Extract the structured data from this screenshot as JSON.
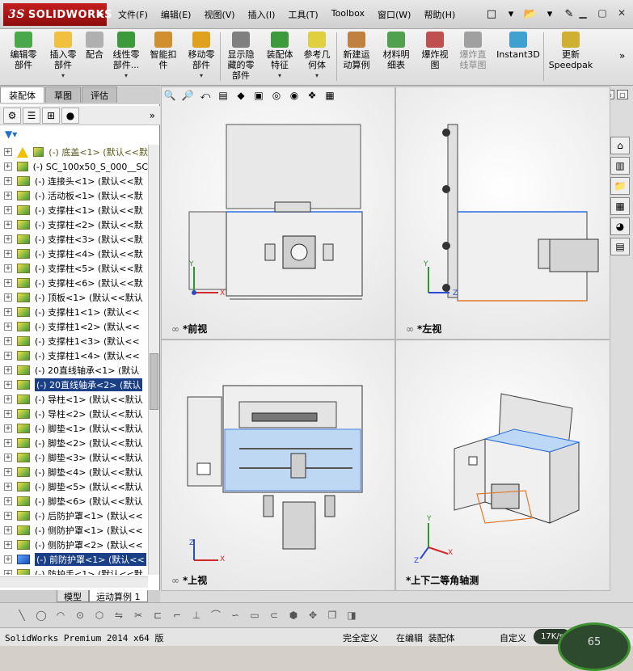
{
  "app": {
    "brand": "SOLIDWORKS",
    "brand_prefix": "3S",
    "status_app": "SolidWorks Premium 2014 x64 版",
    "status_def": "完全定义",
    "status_edit": "在编辑 装配体",
    "status_custom": "自定义",
    "speed": "17K/s",
    "gauge": "65"
  },
  "menus": [
    "文件(F)",
    "编辑(E)",
    "视图(V)",
    "插入(I)",
    "工具(T)",
    "Toolbox",
    "窗口(W)",
    "帮助(H)"
  ],
  "ribbon": [
    {
      "label": "编辑零\n部件",
      "color": "#4aa84a"
    },
    {
      "label": "插入零\n部件",
      "color": "#f0c040"
    },
    {
      "label": "配合",
      "color": "#b0b0b0"
    },
    {
      "label": "线性零\n部件...",
      "color": "#3c9a3c"
    },
    {
      "label": "智能扣\n件",
      "color": "#d09030"
    },
    {
      "label": "移动零\n部件",
      "color": "#e0a020"
    },
    {
      "label": "显示隐\n藏的零\n部件",
      "color": "#808080"
    },
    {
      "label": "装配体\n特征",
      "color": "#3c9a3c"
    },
    {
      "label": "参考几\n何体",
      "color": "#e0d040"
    },
    {
      "label": "新建运\n动算例",
      "color": "#c08040"
    },
    {
      "label": "材料明\n细表",
      "color": "#50a050"
    },
    {
      "label": "爆炸视\n图",
      "color": "#c05050"
    },
    {
      "label": "爆炸直\n线草图",
      "color": "#a0a0a0"
    },
    {
      "label": "Instant3D",
      "color": "#40a0d0"
    },
    {
      "label": "更新\nSpeedpak",
      "color": "#d0b030"
    }
  ],
  "panel_tabs": [
    "装配体",
    "草图",
    "评估"
  ],
  "tree": [
    {
      "label": "(-) 底盖<1> (默认<<默",
      "kind": "warn"
    },
    {
      "label": "(-) SC_100x50_S_000__SC",
      "kind": "normal"
    },
    {
      "label": "(-) 连接头<1> (默认<<默",
      "kind": "normal"
    },
    {
      "label": "(-) 活动板<1> (默认<<默",
      "kind": "normal"
    },
    {
      "label": "(-) 支撑柱<1> (默认<<默",
      "kind": "normal"
    },
    {
      "label": "(-) 支撑柱<2> (默认<<默",
      "kind": "normal"
    },
    {
      "label": "(-) 支撑柱<3> (默认<<默",
      "kind": "normal"
    },
    {
      "label": "(-) 支撑柱<4> (默认<<默",
      "kind": "normal"
    },
    {
      "label": "(-) 支撑柱<5> (默认<<默",
      "kind": "normal"
    },
    {
      "label": "(-) 支撑柱<6> (默认<<默",
      "kind": "normal"
    },
    {
      "label": "(-) 顶板<1> (默认<<默认",
      "kind": "normal"
    },
    {
      "label": "(-) 支撑柱1<1> (默认<<",
      "kind": "normal"
    },
    {
      "label": "(-) 支撑柱1<2> (默认<<",
      "kind": "normal"
    },
    {
      "label": "(-) 支撑柱1<3> (默认<<",
      "kind": "normal"
    },
    {
      "label": "(-) 支撑柱1<4> (默认<<",
      "kind": "normal"
    },
    {
      "label": "(-) 20直线轴承<1> (默认",
      "kind": "normal"
    },
    {
      "label": "(-) 20直线轴承<2> (默认",
      "kind": "selected"
    },
    {
      "label": "(-) 导柱<1> (默认<<默认",
      "kind": "normal"
    },
    {
      "label": "(-) 导柱<2> (默认<<默认",
      "kind": "normal"
    },
    {
      "label": "(-) 脚垫<1> (默认<<默认",
      "kind": "normal"
    },
    {
      "label": "(-) 脚垫<2> (默认<<默认",
      "kind": "normal"
    },
    {
      "label": "(-) 脚垫<3> (默认<<默认",
      "kind": "normal"
    },
    {
      "label": "(-) 脚垫<4> (默认<<默认",
      "kind": "normal"
    },
    {
      "label": "(-) 脚垫<5> (默认<<默认",
      "kind": "normal"
    },
    {
      "label": "(-) 脚垫<6> (默认<<默认",
      "kind": "normal"
    },
    {
      "label": "(-) 后防护罩<1> (默认<<",
      "kind": "normal"
    },
    {
      "label": "(-) 侧防护罩<1> (默认<<",
      "kind": "normal"
    },
    {
      "label": "(-) 侧防护罩<2> (默认<<",
      "kind": "normal"
    },
    {
      "label": "(-) 前防护罩<1> (默认<<",
      "kind": "selected-blue"
    },
    {
      "label": "(-) 防护手<1> (默认<<默",
      "kind": "normal"
    }
  ],
  "bottom_tabs": [
    "模型",
    "运动算例 1"
  ],
  "views": {
    "front": "*前视",
    "left": "*左视",
    "top": "*上视",
    "iso": "*上下二等角轴测"
  },
  "axes": {
    "x": "X",
    "y": "Y",
    "z": "Z"
  }
}
